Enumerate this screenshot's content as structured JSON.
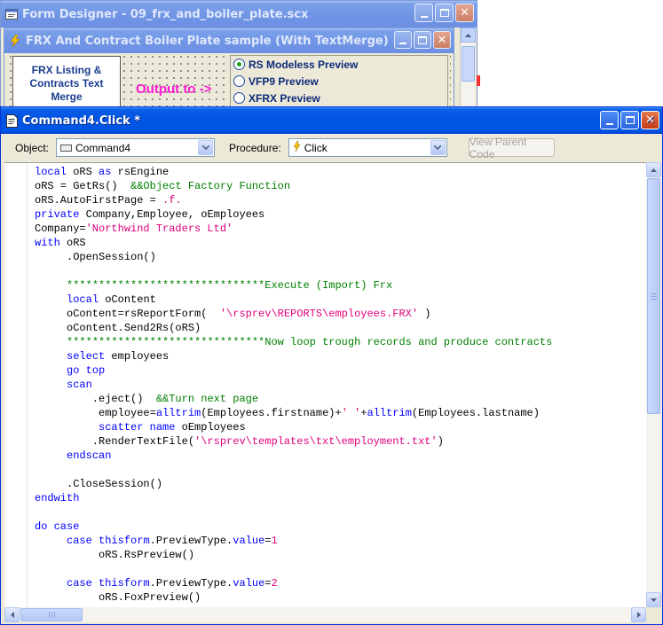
{
  "form_designer": {
    "title": "Form Designer - 09_frx_and_boiler_plate.scx",
    "icon": "form-designer-icon"
  },
  "form_window": {
    "title": "FRX And Contract Boiler Plate sample (With TextMerge)",
    "icon": "form-lightning-icon",
    "command_button_label": "FRX Listing & Contracts Text Merge",
    "output_label": "Output to ->",
    "options": [
      {
        "label": "RS Modeless Preview",
        "selected": true
      },
      {
        "label": "VFP9 Preview",
        "selected": false
      },
      {
        "label": "XFRX Preview",
        "selected": false
      }
    ]
  },
  "code_window": {
    "title": "Command4.Click *",
    "icon": "code-document-icon",
    "object_label": "Object:",
    "object_value": "Command4",
    "procedure_label": "Procedure:",
    "procedure_value": "Click",
    "view_parent_label": "View Parent Code",
    "lines": [
      [
        {
          "t": "local",
          "c": "kw"
        },
        {
          "t": " oRS "
        },
        {
          "t": "as",
          "c": "kw"
        },
        {
          "t": " rsEngine"
        }
      ],
      [
        {
          "t": "oRS = GetRs()  "
        },
        {
          "t": "&&Object Factory Function",
          "c": "cm"
        }
      ],
      [
        {
          "t": "oRS.AutoFirstPage = "
        },
        {
          "t": ".f.",
          "c": "st"
        }
      ],
      [
        {
          "t": "private",
          "c": "kw"
        },
        {
          "t": " Company,Employee, oEmployees"
        }
      ],
      [
        {
          "t": "Company="
        },
        {
          "t": "'Northwind Traders Ltd'",
          "c": "st"
        }
      ],
      [
        {
          "t": "with",
          "c": "kw"
        },
        {
          "t": " oRS"
        }
      ],
      [
        {
          "t": "     .OpenSession()"
        }
      ],
      [
        {
          "t": ""
        }
      ],
      [
        {
          "t": "     "
        },
        {
          "t": "*******************************Execute (Import) Frx",
          "c": "cm"
        }
      ],
      [
        {
          "t": "     "
        },
        {
          "t": "local",
          "c": "kw"
        },
        {
          "t": " oContent"
        }
      ],
      [
        {
          "t": "     oContent=rsReportForm(  "
        },
        {
          "t": "'\\rsprev\\REPORTS\\employees.FRX'",
          "c": "st"
        },
        {
          "t": " )"
        }
      ],
      [
        {
          "t": "     oContent.Send2Rs(oRS)"
        }
      ],
      [
        {
          "t": "     "
        },
        {
          "t": "*******************************Now loop trough records and produce contracts",
          "c": "cm"
        }
      ],
      [
        {
          "t": "     "
        },
        {
          "t": "select",
          "c": "kw"
        },
        {
          "t": " employees"
        }
      ],
      [
        {
          "t": "     "
        },
        {
          "t": "go",
          "c": "kw"
        },
        {
          "t": " "
        },
        {
          "t": "top",
          "c": "kw"
        }
      ],
      [
        {
          "t": "     "
        },
        {
          "t": "scan",
          "c": "kw"
        }
      ],
      [
        {
          "t": "         .eject()  "
        },
        {
          "t": "&&Turn next page",
          "c": "cm"
        }
      ],
      [
        {
          "t": "          employee="
        },
        {
          "t": "alltrim",
          "c": "kw"
        },
        {
          "t": "(Employees.firstname)+"
        },
        {
          "t": "' '",
          "c": "st"
        },
        {
          "t": "+"
        },
        {
          "t": "alltrim",
          "c": "kw"
        },
        {
          "t": "(Employees.lastname)"
        }
      ],
      [
        {
          "t": "          "
        },
        {
          "t": "scatter",
          "c": "kw"
        },
        {
          "t": " "
        },
        {
          "t": "name",
          "c": "kw"
        },
        {
          "t": " oEmployees"
        }
      ],
      [
        {
          "t": "         .RenderTextFile("
        },
        {
          "t": "'\\rsprev\\templates\\txt\\employment.txt'",
          "c": "st"
        },
        {
          "t": ")"
        }
      ],
      [
        {
          "t": "     "
        },
        {
          "t": "endscan",
          "c": "kw"
        }
      ],
      [
        {
          "t": ""
        }
      ],
      [
        {
          "t": "     .CloseSession()"
        }
      ],
      [
        {
          "t": "endwith",
          "c": "kw"
        }
      ],
      [
        {
          "t": ""
        }
      ],
      [
        {
          "t": "do",
          "c": "kw"
        },
        {
          "t": " "
        },
        {
          "t": "case",
          "c": "kw"
        }
      ],
      [
        {
          "t": "     "
        },
        {
          "t": "case",
          "c": "kw"
        },
        {
          "t": " "
        },
        {
          "t": "thisform",
          "c": "kw"
        },
        {
          "t": ".PreviewType."
        },
        {
          "t": "value",
          "c": "kw"
        },
        {
          "t": "="
        },
        {
          "t": "1",
          "c": "st"
        }
      ],
      [
        {
          "t": "          oRS.RsPreview()"
        }
      ],
      [
        {
          "t": ""
        }
      ],
      [
        {
          "t": "     "
        },
        {
          "t": "case",
          "c": "kw"
        },
        {
          "t": " "
        },
        {
          "t": "thisform",
          "c": "kw"
        },
        {
          "t": ".PreviewType."
        },
        {
          "t": "value",
          "c": "kw"
        },
        {
          "t": "="
        },
        {
          "t": "2",
          "c": "st"
        }
      ],
      [
        {
          "t": "          oRS.FoxPreview()"
        }
      ]
    ]
  },
  "colors": {
    "keyword": "#0000ff",
    "comment": "#008000",
    "string": "#e0007c",
    "title_active": "#0054e3",
    "title_inactive": "#7296e6"
  }
}
